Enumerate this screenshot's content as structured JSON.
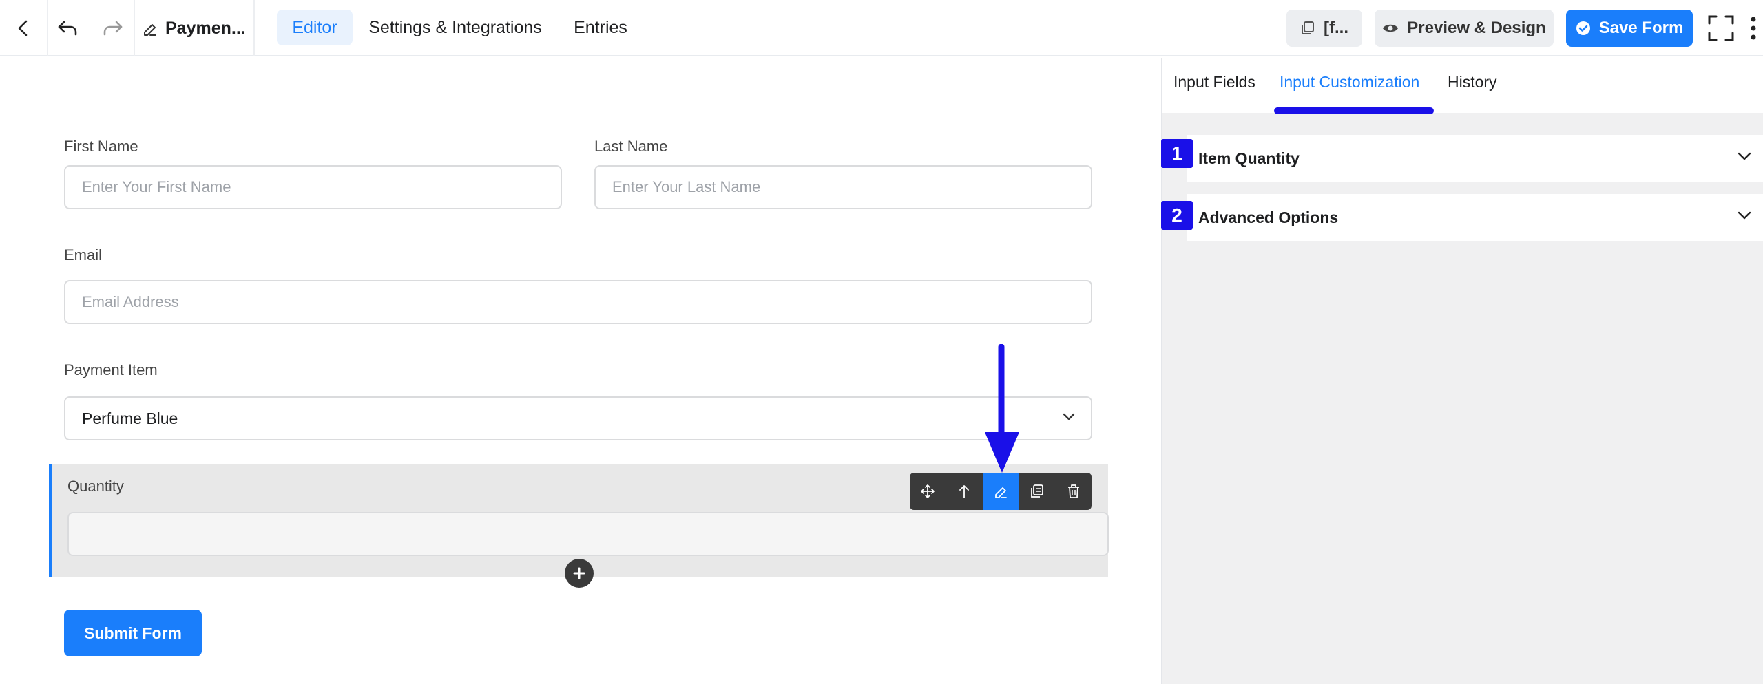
{
  "topbar": {
    "form_title": "Paymen...",
    "tabs": [
      {
        "label": "Editor",
        "active": true
      },
      {
        "label": "Settings & Integrations",
        "active": false
      },
      {
        "label": "Entries",
        "active": false
      }
    ],
    "shortcode_label": "[f...",
    "preview_label": "Preview & Design",
    "save_label": "Save Form"
  },
  "form": {
    "first_name": {
      "label": "First Name",
      "placeholder": "Enter Your First Name"
    },
    "last_name": {
      "label": "Last Name",
      "placeholder": "Enter Your Last Name"
    },
    "email": {
      "label": "Email",
      "placeholder": "Email Address"
    },
    "payment_item": {
      "label": "Payment Item",
      "value": "Perfume Blue"
    },
    "quantity": {
      "label": "Quantity",
      "value": ""
    },
    "submit_label": "Submit Form"
  },
  "sidebar": {
    "tabs": [
      {
        "label": "Input Fields",
        "active": false
      },
      {
        "label": "Input Customization",
        "active": true
      },
      {
        "label": "History",
        "active": false
      }
    ],
    "sections": [
      {
        "badge": "1",
        "label": "Item Quantity"
      },
      {
        "badge": "2",
        "label": "Advanced Options"
      }
    ]
  },
  "colors": {
    "accent": "#1a7efb",
    "annotation": "#1a10e8"
  }
}
